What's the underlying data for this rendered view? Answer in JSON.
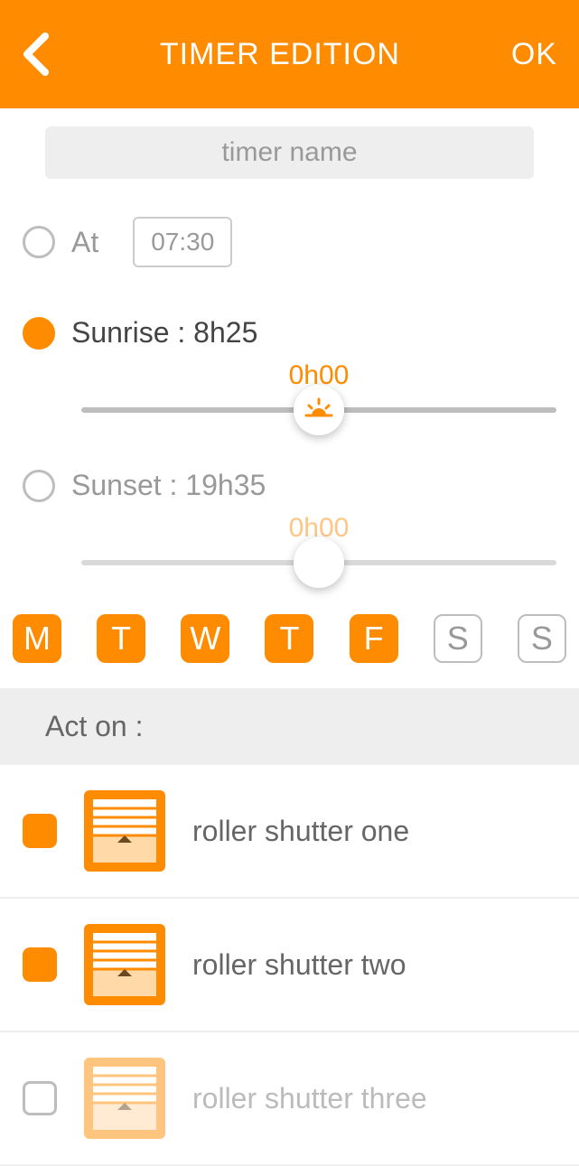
{
  "header": {
    "title": "TIMER EDITION",
    "ok": "OK"
  },
  "name_placeholder": "timer name",
  "options": {
    "at_label": "At",
    "at_time": "07:30",
    "sunrise_label": "Sunrise : 8h25",
    "sunrise_offset": "0h00",
    "sunset_label": "Sunset : 19h35",
    "sunset_offset": "0h00"
  },
  "days": [
    "M",
    "T",
    "W",
    "T",
    "F",
    "S",
    "S"
  ],
  "act_on_label": "Act on :",
  "devices": [
    {
      "label": "roller shutter one"
    },
    {
      "label": "roller shutter two"
    },
    {
      "label": "roller shutter three"
    }
  ]
}
